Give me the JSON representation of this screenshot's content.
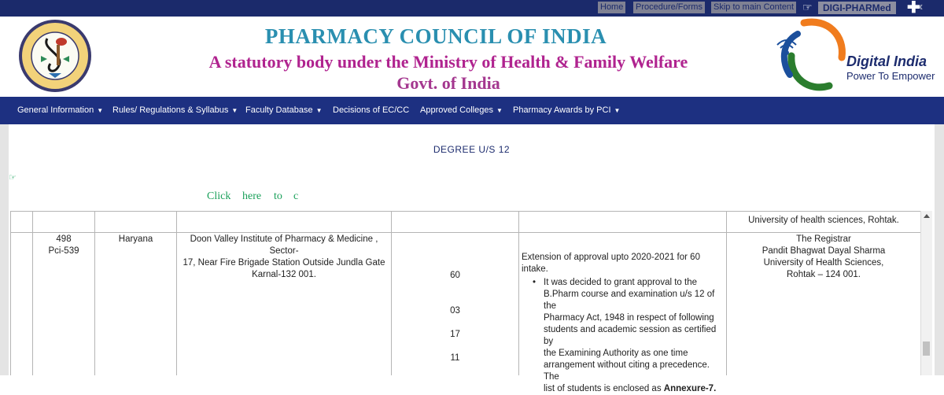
{
  "topbar": {
    "links": [
      "Home",
      "Procedure/Forms",
      "Skip to main Content"
    ],
    "brand": "DIGI-PHARMed",
    "icons": [
      "hand-pointer-icon",
      "plus-icon",
      "chevron-left-icon"
    ]
  },
  "header": {
    "seal_text": "PHARMACY COUNCIL OF INDIA",
    "title": "PHARMACY COUNCIL OF INDIA",
    "subtitle": "A statutory body under the Ministry of Health & Family Welfare",
    "govt": "Govt. of India",
    "digital_india": {
      "name": "Digital India",
      "tagline": "Power To Empower"
    }
  },
  "nav": {
    "items": [
      {
        "label": "General Information",
        "caret": true
      },
      {
        "label": "Rules/ Regulations & Syllabus",
        "caret": true
      },
      {
        "label": "Faculty Database",
        "caret": true
      },
      {
        "label": "Decisions of EC/CC",
        "caret": false
      },
      {
        "label": "Approved Colleges",
        "caret": true
      },
      {
        "label": "Pharmacy Awards by PCI",
        "caret": true
      }
    ]
  },
  "content": {
    "heading": "DEGREE U/S 12",
    "click_words": [
      "Click",
      "here",
      "to",
      "c"
    ]
  },
  "table": {
    "top_row_tail": "University of health sciences, Rohtak.",
    "row": {
      "sno": "498",
      "code": "Pci-539",
      "state": "Haryana",
      "institute": [
        "Doon Valley Institute of Pharmacy & Medicine , Sector-",
        "17, Near Fire Brigade Station Outside Jundla Gate",
        "Karnal-132 001."
      ],
      "numbers": [
        "60",
        "03",
        "17",
        "11"
      ],
      "decision_intro": "Extension of approval upto 2020-2021 for 60 intake.",
      "decision_bullet": [
        "It was decided to grant approval to the",
        "B.Pharm course and examination u/s 12 of the",
        "Pharmacy Act, 1948 in respect of following",
        "students and academic session as certified by",
        "the Examining Authority as one time",
        "arrangement without citing a precedence.  The",
        "list of students is enclosed as"
      ],
      "annexure": "Annexure-7.",
      "examining_authority": [
        "The Registrar",
        "Pandit Bhagwat Dayal Sharma",
        "University of Health Sciences,",
        "Rohtak – 124 001."
      ]
    }
  },
  "colors": {
    "topbar_bg": "#1b2a6b",
    "nav_bg": "#1d3081",
    "title_blue": "#2a8fb0",
    "title_magenta": "#b0238f",
    "link_green": "#1aa05a"
  }
}
